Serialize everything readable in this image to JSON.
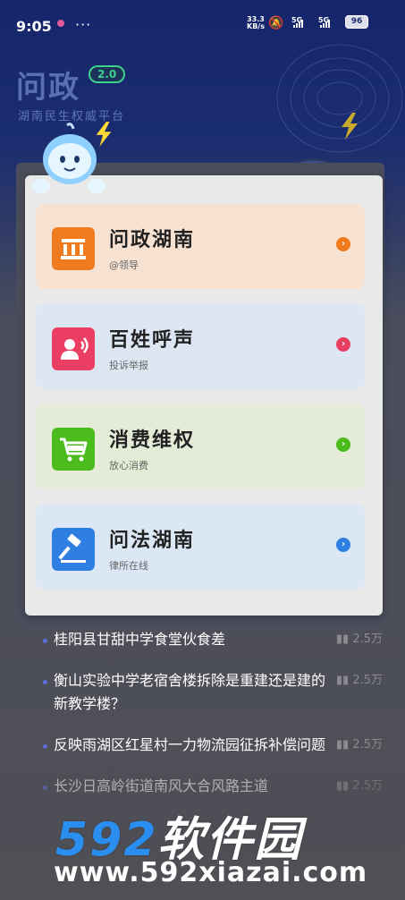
{
  "status_bar": {
    "time": "9:05",
    "more": "···",
    "net_speed_value": "33.3",
    "net_speed_unit": "KB/s",
    "sim1": "5G",
    "sim2": "5G",
    "battery": "96"
  },
  "header": {
    "title": "问政",
    "version": "2.0",
    "subtitle": "湖南民生权威平台"
  },
  "menu": {
    "items": [
      {
        "title": "问政湖南",
        "subtitle": "@领导",
        "icon": "bank-icon",
        "bg": "#f7e2d2",
        "accent": "#f07a1e"
      },
      {
        "title": "百姓呼声",
        "subtitle": "投诉举报",
        "icon": "speaker-person-icon",
        "bg": "#dde6f3",
        "accent": "#ea3f63"
      },
      {
        "title": "消费维权",
        "subtitle": "放心消费",
        "icon": "shopping-cart-icon",
        "bg": "#e4ecd8",
        "accent": "#4cbb1d"
      },
      {
        "title": "问法湖南",
        "subtitle": "律所在线",
        "icon": "gavel-icon",
        "bg": "#dbe7f4",
        "accent": "#2f7ee2"
      }
    ]
  },
  "news": {
    "items": [
      {
        "title": "桂阳县甘甜中学食堂伙食差",
        "count": "2.5万"
      },
      {
        "title": "衡山实验中学老宿舍楼拆除是重建还是建的新教学楼？",
        "count": "2.5万"
      },
      {
        "title": "反映雨湖区红星村一力物流园征拆补偿问题",
        "count": "2.5万"
      },
      {
        "title": "长沙日高岭街道南风大合风路主道",
        "count": "2.5万"
      }
    ]
  },
  "watermark": {
    "brand_number": "592",
    "brand_text": "软件园",
    "url": "www.592xiazai.com"
  }
}
